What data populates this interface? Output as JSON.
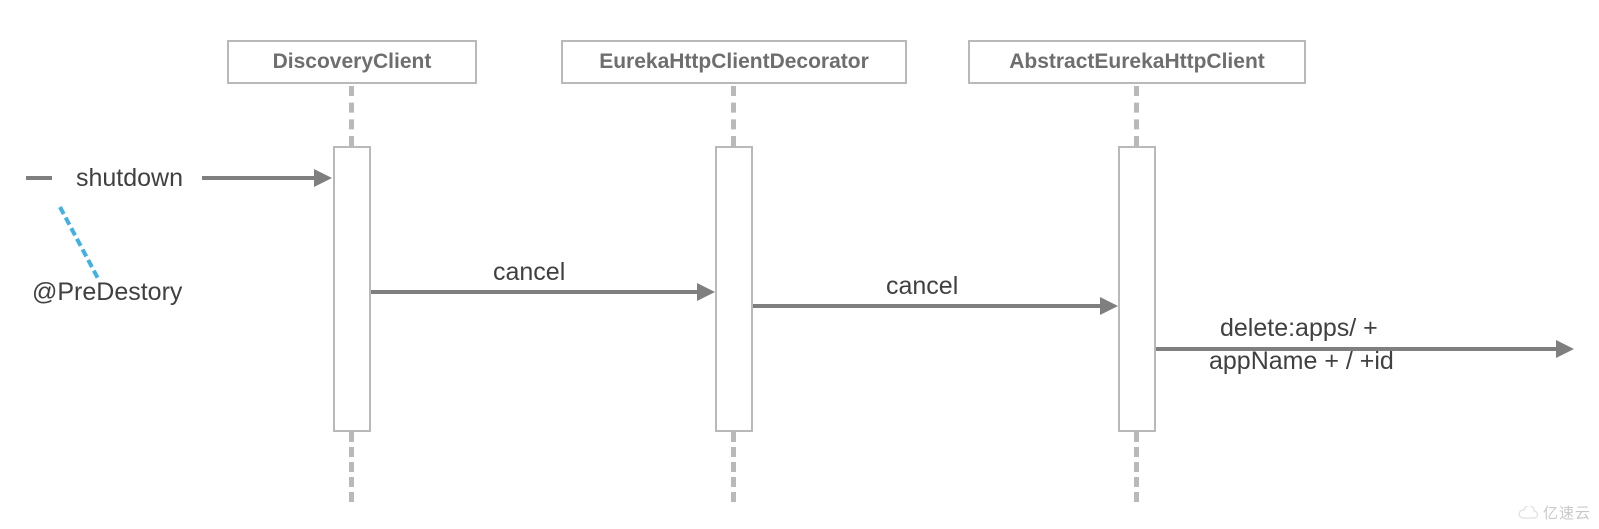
{
  "participants": {
    "p1": "DiscoveryClient",
    "p2": "EurekaHttpClientDecorator",
    "p3": "AbstractEurekaHttpClient"
  },
  "messages": {
    "shutdown": "shutdown",
    "cancel1": "cancel",
    "cancel2": "cancel",
    "delete_line1": "delete:apps/ +",
    "delete_line2": "appName + / +id"
  },
  "trigger": "@PreDestory",
  "watermark": "亿速云"
}
